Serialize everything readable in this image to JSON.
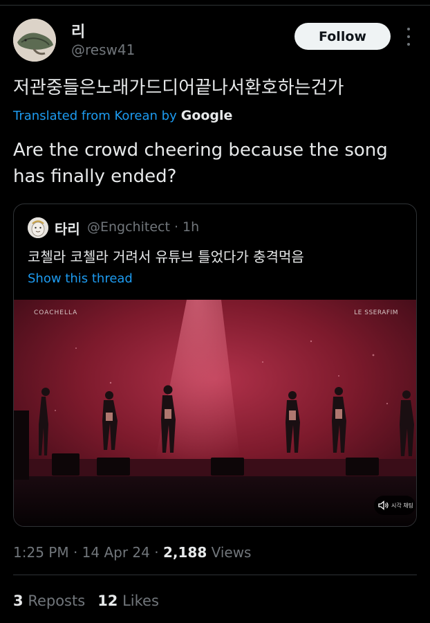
{
  "author": {
    "name": "리",
    "handle": "@resw41"
  },
  "follow_label": "Follow",
  "tweet": {
    "original_text": "저관중들은노래가드디어끝나서환호하는건가",
    "translated_from": "Translated from Korean by",
    "translator": "Google",
    "translated_text": "Are the crowd cheering because the song has finally ended?"
  },
  "quote": {
    "name": "타리",
    "meta": "@Engchitect · 1h",
    "text": "코첼라 코첼라 거려서 유튜브 틀었다가 충격먹음",
    "show_thread": "Show this thread",
    "video": {
      "overlay_left": "COACHELLA",
      "overlay_right": "LE SSERAFIM",
      "caption_pill": "시각 채팅"
    }
  },
  "meta": {
    "time": "1:25 PM",
    "date": "14 Apr 24",
    "views_count": "2,188",
    "views_label": "Views"
  },
  "stats": {
    "reposts_count": "3",
    "reposts_label": "Reposts",
    "likes_count": "12",
    "likes_label": "Likes"
  },
  "colors": {
    "background": "#000000",
    "link": "#1d9bf0",
    "muted": "#71767b",
    "text": "#e7e9ea"
  }
}
